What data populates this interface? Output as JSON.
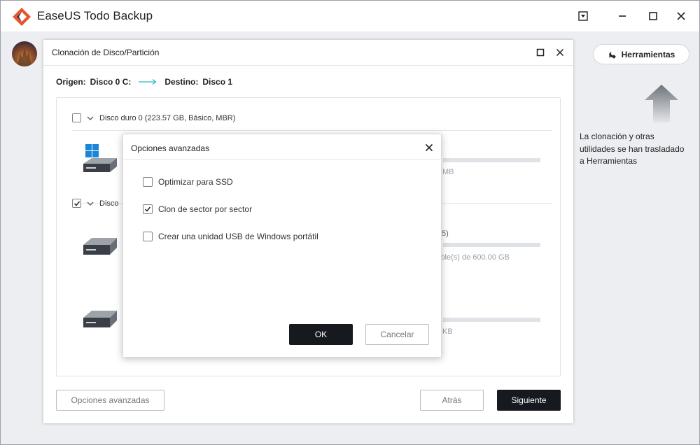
{
  "app": {
    "title": "EaseUS Todo Backup",
    "brand_color": "#e8552a"
  },
  "header": {
    "tools_label": "Herramientas",
    "hint_lines": [
      "La clonación  y otras",
      "utilidades se han trasladado",
      "a Herramientas"
    ]
  },
  "dialog": {
    "title": "Clonación de Disco/Partición",
    "origin_label": "Origen:",
    "origin_value": "Disco 0 C:",
    "dest_label": "Destino:",
    "dest_value": "Disco 1",
    "disks": [
      {
        "label": "Disco duro 0 (223.57 GB, Básico, MBR)",
        "checked": false
      },
      {
        "label": "Disco",
        "checked": true
      }
    ],
    "partial_texts": {
      "p1": "MB",
      "p2": "5)",
      "p3": "ible(s) de 600.00 GB",
      "p4": "KB"
    },
    "buttons": {
      "advanced": "Opciones avanzadas",
      "back": "Atrás",
      "next": "Siguiente"
    }
  },
  "modal": {
    "title": "Opciones avanzadas",
    "options": [
      {
        "label": "Optimizar para SSD",
        "checked": false
      },
      {
        "label": "Clon de sector por sector",
        "checked": true
      },
      {
        "label": "Crear una unidad USB de Windows portátil",
        "checked": false
      }
    ],
    "ok_label": "OK",
    "cancel_label": "Cancelar"
  }
}
